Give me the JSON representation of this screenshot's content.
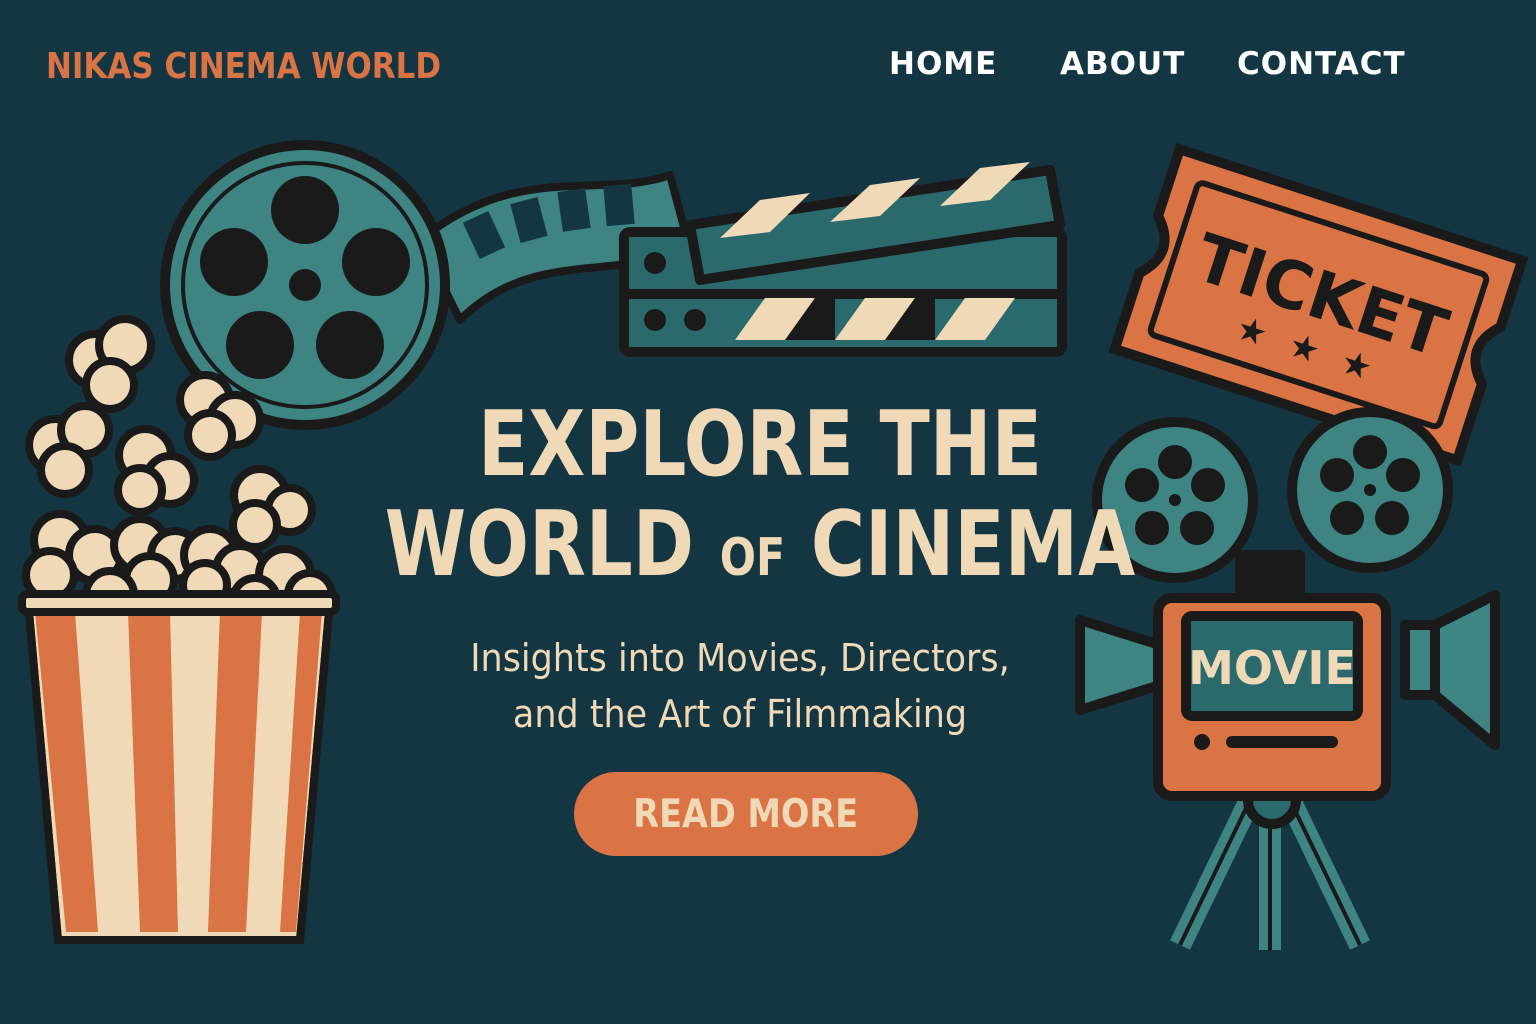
{
  "header": {
    "brand": "NIKAS CINEMA WORLD",
    "nav": [
      {
        "label": "HOME"
      },
      {
        "label": "ABOUT"
      },
      {
        "label": "CONTACT"
      }
    ]
  },
  "hero": {
    "title_line1": "EXPLORE THE",
    "title_line2_a": "WORLD",
    "title_line2_small": "OF",
    "title_line2_b": "CINEMA",
    "subtitle_line1": "Insights into Movies, Directors,",
    "subtitle_line2": "and the Art of Filmmaking",
    "cta_label": "READ MORE"
  },
  "illustrations": {
    "ticket_text": "TICKET",
    "camera_screen_text": "MOVIE",
    "icons": [
      "film-reel-icon",
      "film-strip-icon",
      "clapperboard-icon",
      "popcorn-icon",
      "ticket-icon",
      "movie-camera-icon"
    ]
  },
  "colors": {
    "background": "#143642",
    "accent_orange": "#DB7445",
    "cream": "#EFD9B7",
    "teal": "#3D8483",
    "ink": "#1A1A1A",
    "nav_text": "#FFFFFF"
  }
}
